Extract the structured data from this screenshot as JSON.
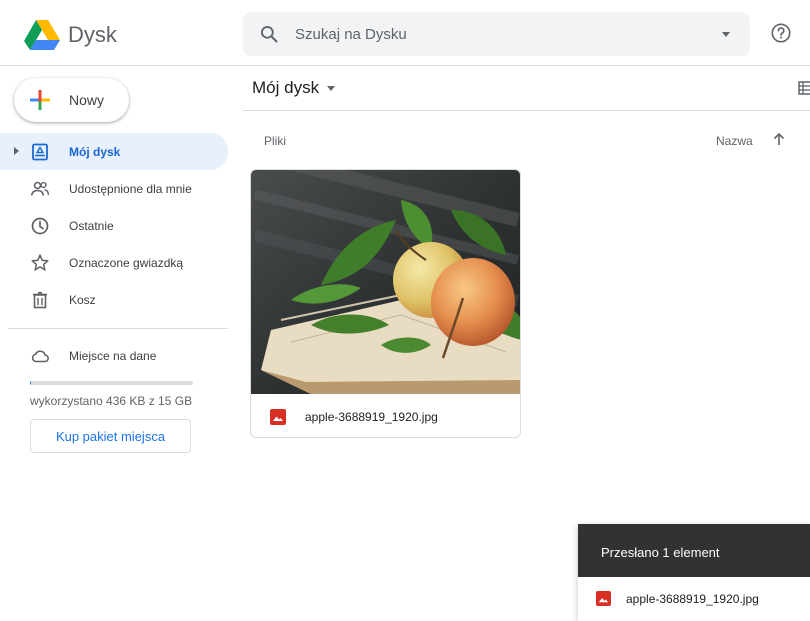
{
  "app": {
    "title": "Dysk"
  },
  "search": {
    "placeholder": "Szukaj na Dysku"
  },
  "sidebar": {
    "new_label": "Nowy",
    "items": [
      {
        "label": "Mój dysk",
        "icon": "my-drive-icon"
      },
      {
        "label": "Udostępnione dla mnie",
        "icon": "shared-people-icon"
      },
      {
        "label": "Ostatnie",
        "icon": "clock-icon"
      },
      {
        "label": "Oznaczone gwiazdką",
        "icon": "star-icon"
      },
      {
        "label": "Kosz",
        "icon": "trash-icon"
      }
    ],
    "storage": {
      "label": "Miejsce na dane",
      "usage_text": "wykorzystano 436 KB z 15 GB",
      "used_fraction": 3e-05,
      "buy_label": "Kup pakiet miejsca"
    }
  },
  "main": {
    "title": "Mój dysk",
    "section_label": "Pliki",
    "sort_label": "Nazwa",
    "files": [
      {
        "name": "apple-3688919_1920.jpg",
        "icon": "image-file-icon"
      }
    ]
  },
  "upload": {
    "title": "Przesłano 1 element",
    "file_name": "apple-3688919_1920.jpg"
  },
  "colors": {
    "accent": "#1a73e8",
    "active_bg": "#e8f0fe",
    "active_text": "#1967d2",
    "image_icon": "#d93025",
    "toast_bg": "#323232"
  }
}
